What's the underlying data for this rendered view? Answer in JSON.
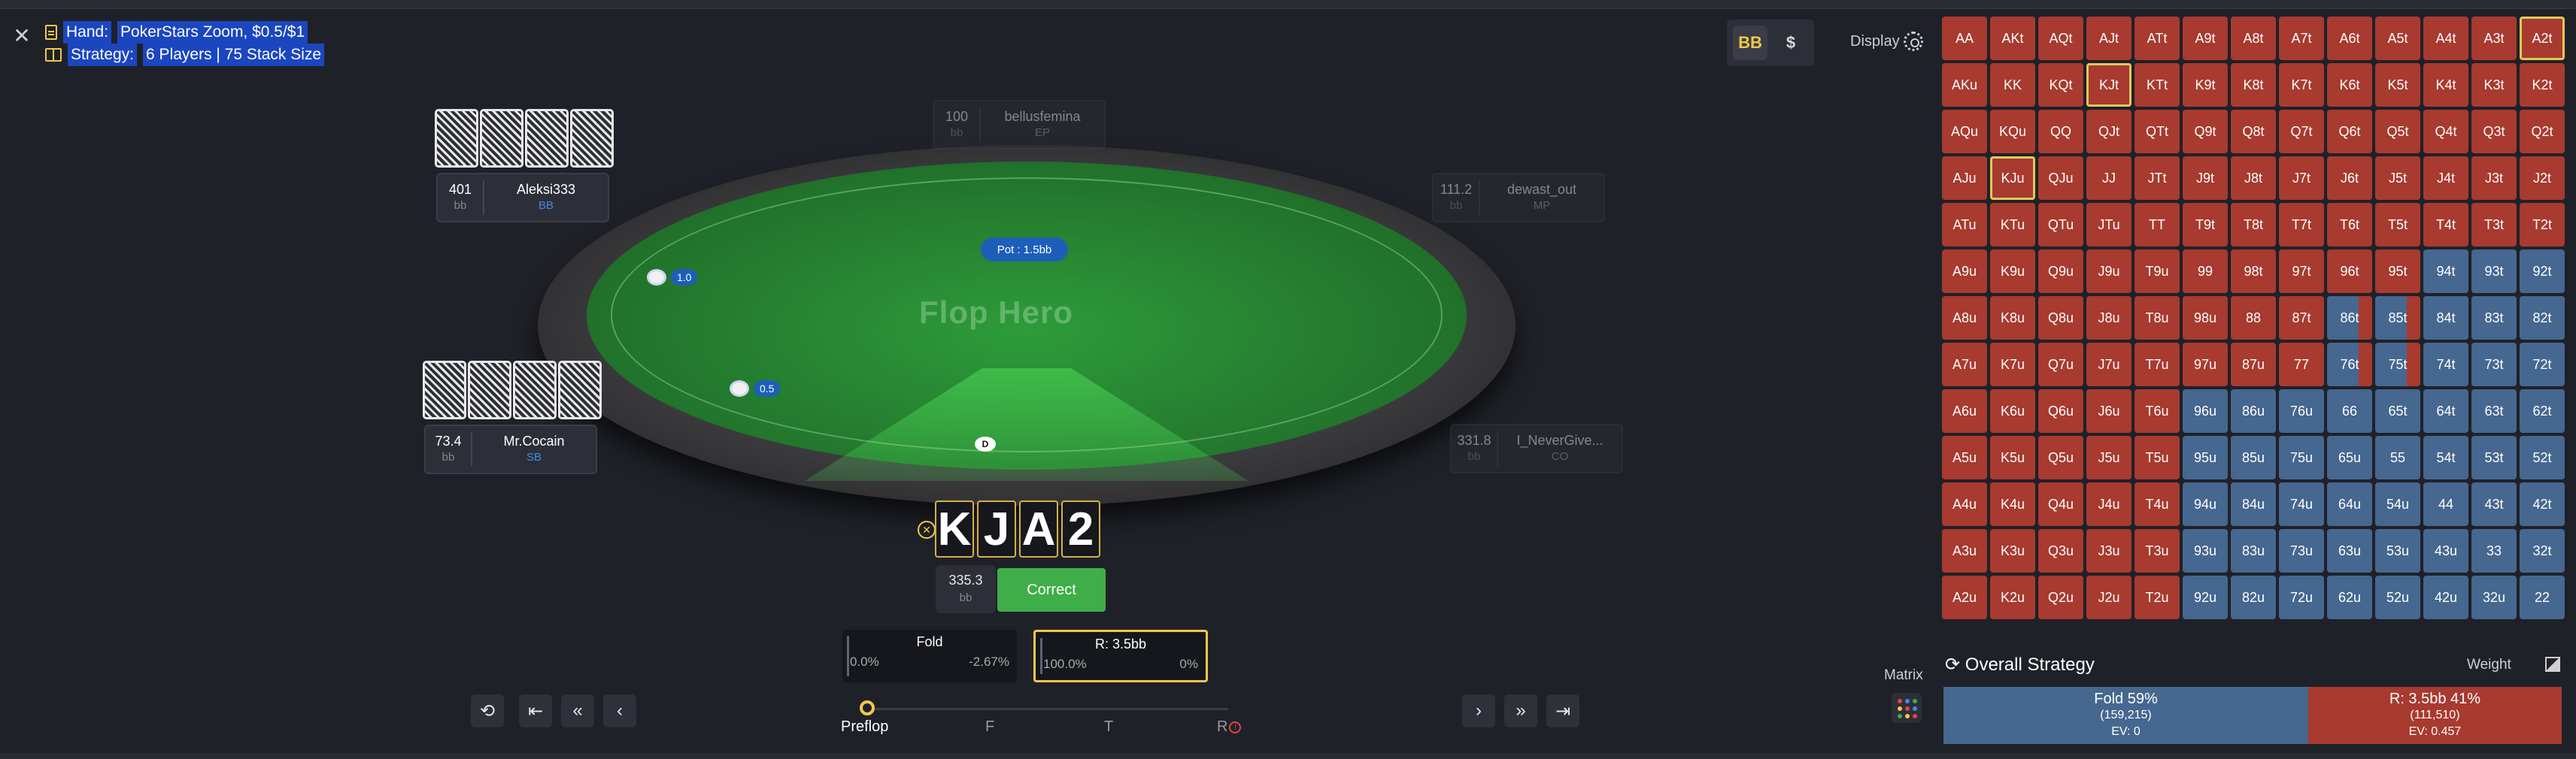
{
  "header": {
    "hand_label": "Hand:",
    "hand_value": "PokerStars Zoom, $0.5/$1",
    "strategy_label": "Strategy:",
    "strategy_value": "6 Players | 75 Stack Size"
  },
  "display": {
    "bb_label": "BB",
    "dollar_label": "$",
    "display_label": "Display"
  },
  "table": {
    "logo": "Flop Hero",
    "pot": "Pot : 1.5bb",
    "bets": [
      {
        "amount": "1.0"
      },
      {
        "amount": "0.5"
      }
    ],
    "dealer": "D"
  },
  "seats": {
    "bb": {
      "stack": "401",
      "unit": "bb",
      "name": "Aleksi333",
      "pos": "BB"
    },
    "ep": {
      "stack": "100",
      "unit": "bb",
      "name": "bellusfemina",
      "pos": "EP"
    },
    "mp": {
      "stack": "111.2",
      "unit": "bb",
      "name": "dewast_out",
      "pos": "MP"
    },
    "sb": {
      "stack": "73.4",
      "unit": "bb",
      "name": "Mr.Cocain",
      "pos": "SB"
    },
    "co": {
      "stack": "331.8",
      "unit": "bb",
      "name": "I_NeverGive...",
      "pos": "CO"
    }
  },
  "hero": {
    "cards": [
      "K",
      "J",
      "A",
      "2"
    ],
    "stack": "335.3",
    "unit": "bb",
    "result": "Correct"
  },
  "actions": [
    {
      "name": "Fold",
      "freq": "0.0%",
      "ev": "-2.67%"
    },
    {
      "name": "R: 3.5bb",
      "freq": "100.0%",
      "ev": "0%"
    }
  ],
  "streets": [
    "Preflop",
    "F",
    "T",
    "R"
  ],
  "matrix": {
    "label": "Matrix",
    "cells": [
      [
        "AA",
        "AKt",
        "AQt",
        "AJt",
        "ATt",
        "A9t",
        "A8t",
        "A7t",
        "A6t",
        "A5t",
        "A4t",
        "A3t",
        "A2t"
      ],
      [
        "AKu",
        "KK",
        "KQt",
        "KJt",
        "KTt",
        "K9t",
        "K8t",
        "K7t",
        "K6t",
        "K5t",
        "K4t",
        "K3t",
        "K2t"
      ],
      [
        "AQu",
        "KQu",
        "QQ",
        "QJt",
        "QTt",
        "Q9t",
        "Q8t",
        "Q7t",
        "Q6t",
        "Q5t",
        "Q4t",
        "Q3t",
        "Q2t"
      ],
      [
        "AJu",
        "KJu",
        "QJu",
        "JJ",
        "JTt",
        "J9t",
        "J8t",
        "J7t",
        "J6t",
        "J5t",
        "J4t",
        "J3t",
        "J2t"
      ],
      [
        "ATu",
        "KTu",
        "QTu",
        "JTu",
        "TT",
        "T9t",
        "T8t",
        "T7t",
        "T6t",
        "T5t",
        "T4t",
        "T3t",
        "T2t"
      ],
      [
        "A9u",
        "K9u",
        "Q9u",
        "J9u",
        "T9u",
        "99",
        "98t",
        "97t",
        "96t",
        "95t",
        "94t",
        "93t",
        "92t"
      ],
      [
        "A8u",
        "K8u",
        "Q8u",
        "J8u",
        "T8u",
        "98u",
        "88",
        "87t",
        "86t",
        "85t",
        "84t",
        "83t",
        "82t"
      ],
      [
        "A7u",
        "K7u",
        "Q7u",
        "J7u",
        "T7u",
        "97u",
        "87u",
        "77",
        "76t",
        "75t",
        "74t",
        "73t",
        "72t"
      ],
      [
        "A6u",
        "K6u",
        "Q6u",
        "J6u",
        "T6u",
        "96u",
        "86u",
        "76u",
        "66",
        "65t",
        "64t",
        "63t",
        "62t"
      ],
      [
        "A5u",
        "K5u",
        "Q5u",
        "J5u",
        "T5u",
        "95u",
        "85u",
        "75u",
        "65u",
        "55",
        "54t",
        "53t",
        "52t"
      ],
      [
        "A4u",
        "K4u",
        "Q4u",
        "J4u",
        "T4u",
        "94u",
        "84u",
        "74u",
        "64u",
        "54u",
        "44",
        "43t",
        "42t"
      ],
      [
        "A3u",
        "K3u",
        "Q3u",
        "J3u",
        "T3u",
        "93u",
        "83u",
        "73u",
        "63u",
        "53u",
        "43u",
        "33",
        "32t"
      ],
      [
        "A2u",
        "K2u",
        "Q2u",
        "J2u",
        "T2u",
        "92u",
        "82u",
        "72u",
        "62u",
        "52u",
        "42u",
        "32u",
        "22"
      ]
    ],
    "colors": [
      "rrrrrrrrrrrrr",
      "rrrrrrrrrrrrr",
      "rrrrrrrrrrrrr",
      "rrrrrrrrrrrrr",
      "rrrrrrrrrrrrr",
      "rrrrrrrrrrbbb",
      "rrrrrrrrmmbbb",
      "rrrrrrrrmmbbb",
      "rrrrrbbbbbbbb",
      "rrrrrbbbbbbbb",
      "rrrrrbbbbbbbb",
      "rrrrrbbbbbbbb",
      "rrrrrbbbbbbbb"
    ],
    "highlighted": [
      "A2t",
      "KJt",
      "KJu"
    ]
  },
  "overall": {
    "title": "Overall Strategy",
    "weight_label": "Weight",
    "fold": {
      "label": "Fold 59%",
      "combos": "(159,215)",
      "ev": "EV: 0",
      "share": 0.59
    },
    "raise": {
      "label": "R: 3.5bb 41%",
      "combos": "(111,510)",
      "ev": "EV: 0.457",
      "share": 0.41
    }
  },
  "colors": {
    "accent": "#f4c84a",
    "raise": "#a83a2f",
    "fold": "#46678f",
    "correct": "#3fae49",
    "felt": "#247a2e"
  }
}
